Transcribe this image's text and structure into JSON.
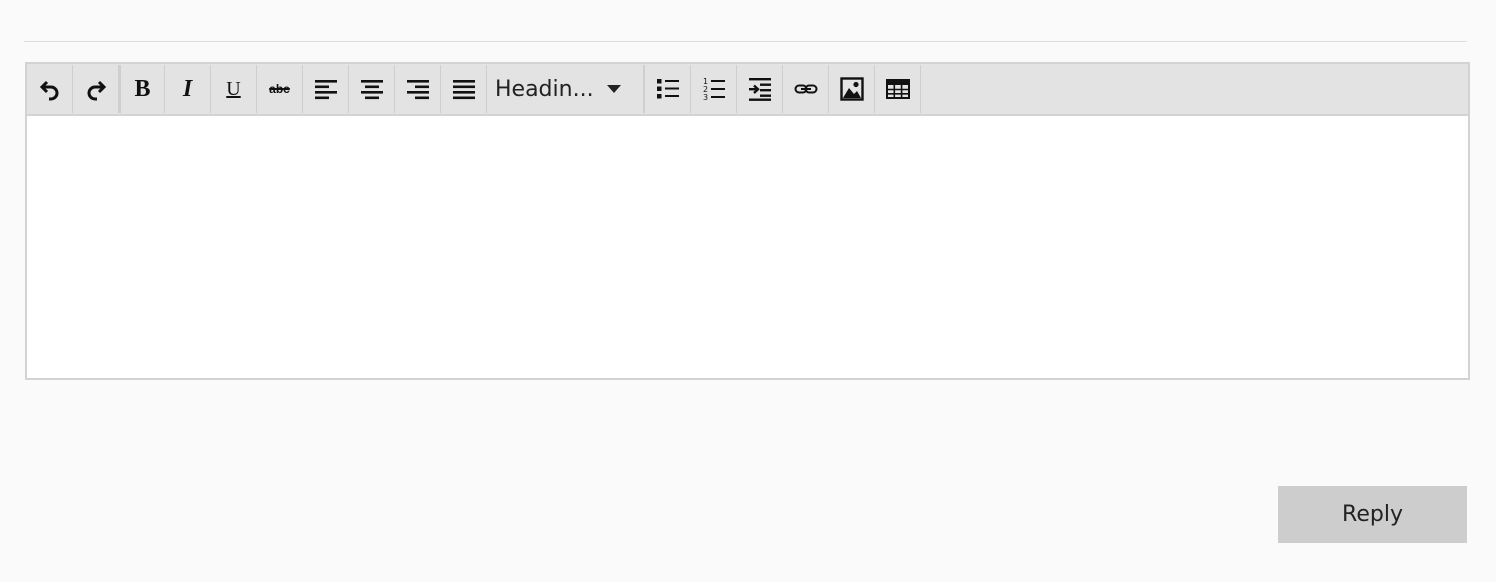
{
  "toolbar": {
    "buttons": {
      "undo": "undo-icon",
      "redo": "redo-icon",
      "bold_glyph": "B",
      "italic_glyph": "I",
      "underline_glyph": "U",
      "strikethrough_glyph": "abc",
      "align_left": "align-left-icon",
      "align_center": "align-center-icon",
      "align_right": "align-right-icon",
      "align_justify": "align-justify-icon",
      "bullet_list": "bullet-list-icon",
      "numbered_list": "numbered-list-icon",
      "indent": "indent-icon",
      "link": "link-icon",
      "image": "image-icon",
      "table": "table-icon"
    },
    "heading_select": {
      "value": "Headin..."
    },
    "colors": {
      "background": "#e3e3e3",
      "border": "#d3d3d3"
    }
  },
  "editor": {
    "content": ""
  },
  "actions": {
    "reply_label": "Reply",
    "reply_color": "#cdcdcd"
  }
}
